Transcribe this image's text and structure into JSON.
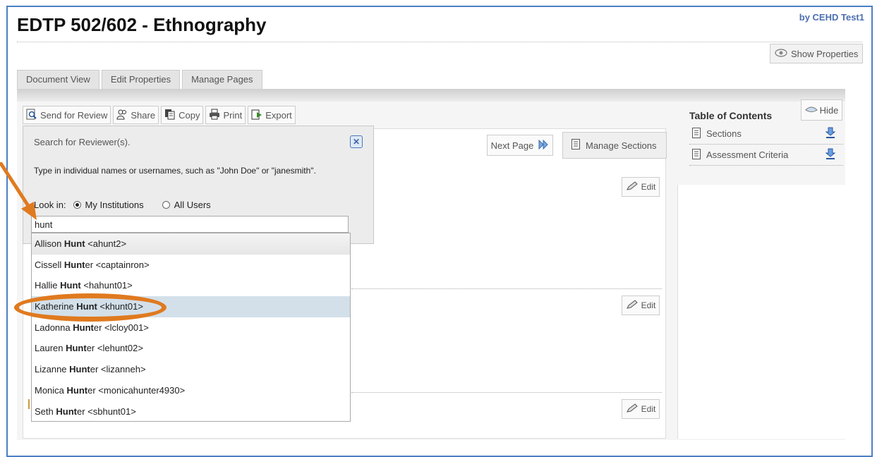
{
  "header": {
    "title": "EDTP 502/602 - Ethnography",
    "byline": "by CEHD Test1",
    "show_properties": "Show Properties"
  },
  "tabs": [
    "Document View",
    "Edit Properties",
    "Manage Pages"
  ],
  "toolbar": {
    "send_for_review": "Send for Review",
    "share": "Share",
    "copy": "Copy",
    "print": "Print",
    "export": "Export"
  },
  "document": {
    "next_page": "Next Page",
    "manage_sections": "Manage Sections",
    "edit_label": "Edit"
  },
  "toc": {
    "title": "Table of Contents",
    "hide": "Hide",
    "items": [
      "Sections",
      "Assessment Criteria"
    ]
  },
  "reviewer": {
    "title": "Search for Reviewer(s).",
    "instructions": "Type in individual names or usernames, such as \"John Doe\" or \"janesmith\".",
    "look_in_label": "Look in:",
    "options": [
      "My Institutions",
      "All Users"
    ],
    "selected_option": "My Institutions",
    "search_value": "hunt",
    "suggestions": [
      {
        "first": "Allison ",
        "bold": "Hunt",
        "rest": " <ahunt2>"
      },
      {
        "first": "Cissell ",
        "bold": "Hunt",
        "rest": "er <captainron>"
      },
      {
        "first": "Hallie ",
        "bold": "Hunt",
        "rest": " <hahunt01>"
      },
      {
        "first": "Katherine ",
        "bold": "Hunt",
        "rest": " <khunt01>"
      },
      {
        "first": "Ladonna ",
        "bold": "Hunt",
        "rest": "er <lcloy001>"
      },
      {
        "first": "Lauren ",
        "bold": "Hunt",
        "rest": "er <lehunt02>"
      },
      {
        "first": "Lizanne ",
        "bold": "Hunt",
        "rest": "er <lizanneh>"
      },
      {
        "first": "Monica ",
        "bold": "Hunt",
        "rest": "er <monicahunter4930>"
      },
      {
        "first": "Seth ",
        "bold": "Hunt",
        "rest": "er <sbhunt01>"
      }
    ],
    "highlighted_index": 3
  },
  "colors": {
    "annotation": "#e07a1f",
    "frame": "#4d7fc4"
  }
}
